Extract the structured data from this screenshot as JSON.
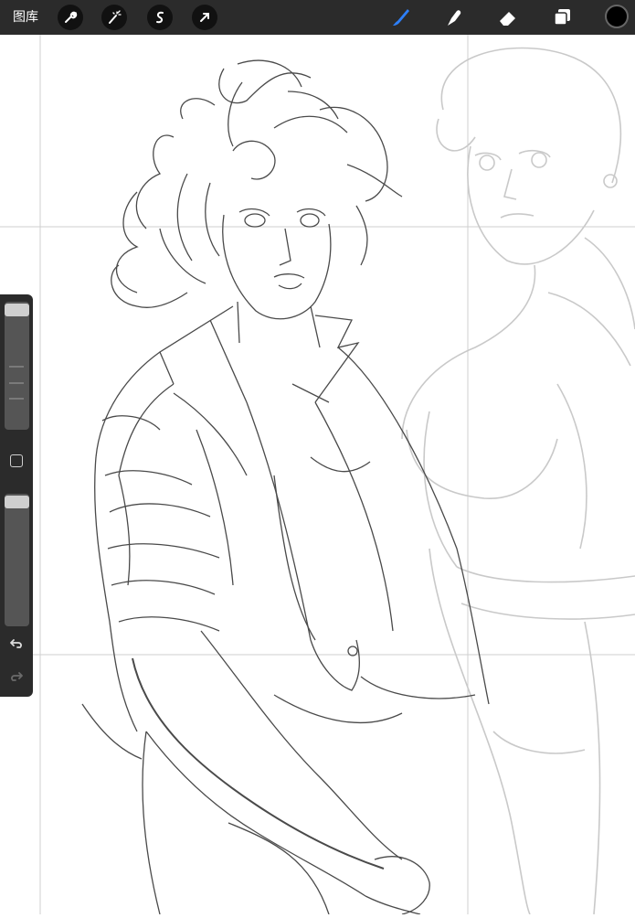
{
  "topbar": {
    "gallery_label": "图库",
    "actions": [
      {
        "name": "wrench-icon"
      },
      {
        "name": "magic-wand-icon"
      },
      {
        "name": "selection-icon"
      },
      {
        "name": "transform-arrow-icon"
      }
    ],
    "tools": [
      {
        "name": "brush-icon",
        "active": true
      },
      {
        "name": "smudge-icon",
        "active": false
      },
      {
        "name": "eraser-icon",
        "active": false
      },
      {
        "name": "layers-icon",
        "active": false
      }
    ],
    "current_color": "#000000"
  },
  "colors": {
    "toolbar_bg": "#2b2b2b",
    "active_tool": "#2d7ff9",
    "canvas_bg": "#ffffff",
    "sketch_line": "#555555",
    "guide_line": "#c8c8c8"
  },
  "sidebar": {
    "brush_size_level": 0.05,
    "opacity_level": 0.05,
    "undo_icon": "undo-icon",
    "redo_icon": "redo-icon",
    "modify_icon": "modify-square-icon"
  }
}
